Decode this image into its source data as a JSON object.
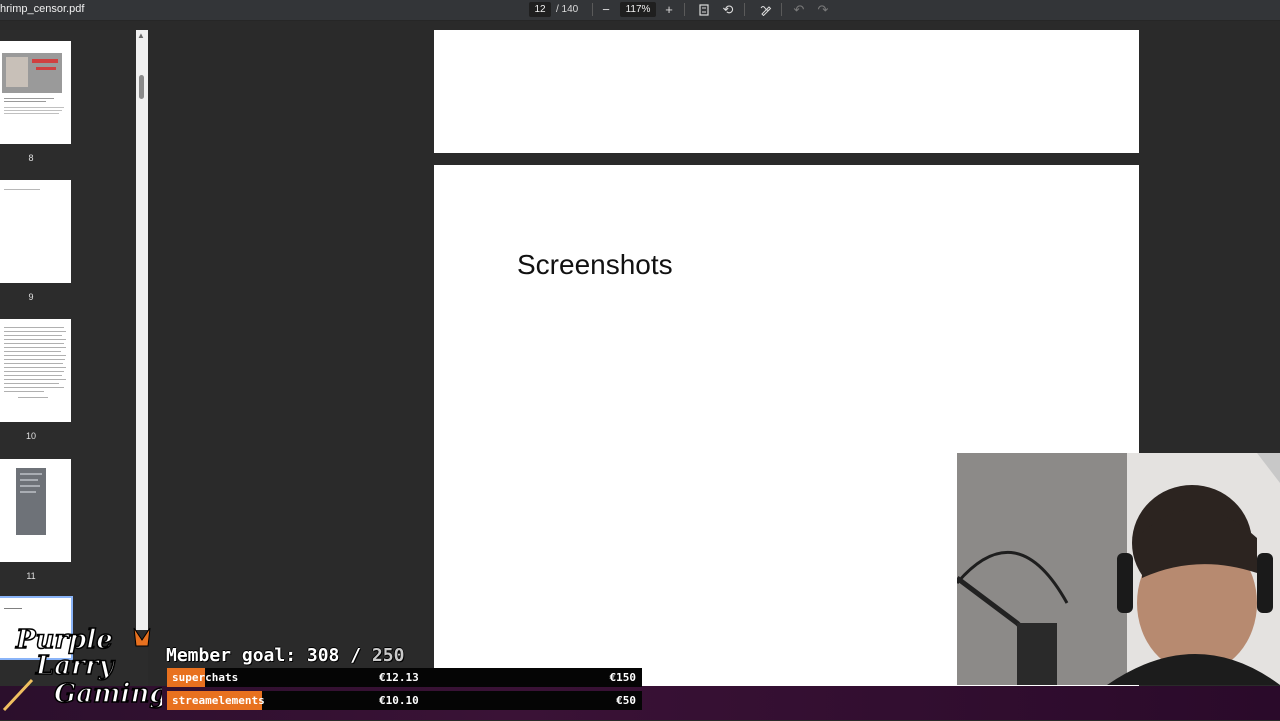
{
  "toolbar": {
    "document_title": "hrimp_censor.pdf",
    "current_page": "12",
    "page_total": "/ 140",
    "zoom": "117%",
    "icons": {
      "zoom_out": "minus-icon",
      "zoom_in": "plus-icon",
      "fit_page": "fit-page-icon",
      "rotate": "rotate-icon",
      "annotate": "annotate-icon",
      "undo": "undo-icon",
      "redo": "redo-icon"
    }
  },
  "sidebar": {
    "thumbnails": [
      {
        "label": "8"
      },
      {
        "label": "9"
      },
      {
        "label": "10"
      },
      {
        "label": "11"
      }
    ]
  },
  "document": {
    "slide_title": "Screenshots"
  },
  "overlay": {
    "logo_text": [
      "Purple",
      "Larry",
      "Gaming"
    ],
    "member_goal_label": "Member goal: 308 / ",
    "member_goal_target": "250",
    "goals": [
      {
        "label": "superchats",
        "current": "€12.13",
        "target": "€150",
        "progress": 0.08
      },
      {
        "label": "streamelements",
        "current": "€10.10",
        "target": "€50",
        "progress": 0.2
      }
    ],
    "colors": {
      "goal_fill": "#e8711f",
      "strip": "#3a1236"
    }
  }
}
